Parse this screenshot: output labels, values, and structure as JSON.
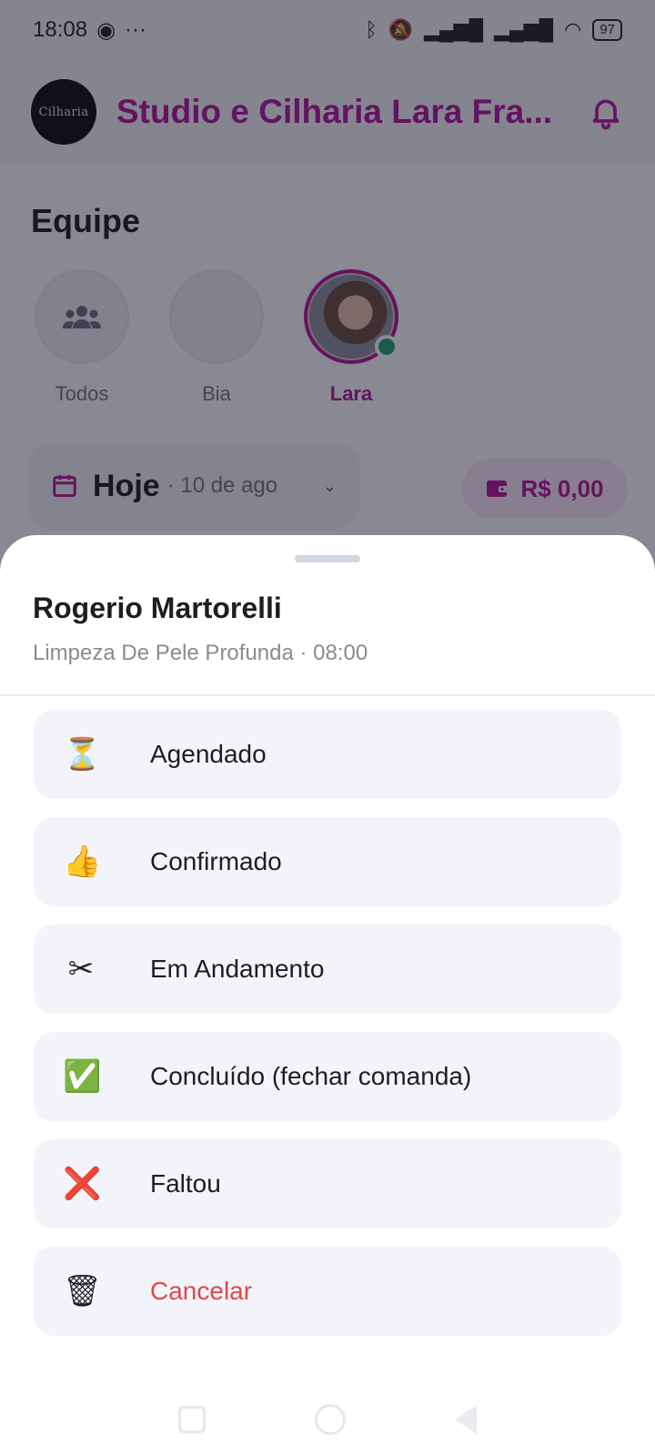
{
  "status_bar": {
    "time": "18:08",
    "battery": "97"
  },
  "header": {
    "title": "Studio e Cilharia Lara Fra...",
    "logo_text": "Cilharia"
  },
  "team": {
    "title": "Equipe",
    "members": [
      {
        "label": "Todos"
      },
      {
        "label": "Bia"
      },
      {
        "label": "Lara"
      }
    ]
  },
  "date_filter": {
    "main": "Hoje",
    "sub": "· 10 de ago"
  },
  "balance": {
    "value": "R$ 0,00"
  },
  "sheet": {
    "client_name": "Rogerio Martorelli",
    "subtitle": "Limpeza De Pele Profunda · 08:00",
    "actions": [
      {
        "label": "Agendado",
        "icon": "⏳",
        "icon_name": "hourglass-icon"
      },
      {
        "label": "Confirmado",
        "icon": "👍",
        "icon_name": "thumbs-up-icon"
      },
      {
        "label": "Em Andamento",
        "icon": "✂",
        "icon_name": "scissors-icon"
      },
      {
        "label": "Concluído (fechar comanda)",
        "icon": "✅",
        "icon_name": "check-mark-icon"
      },
      {
        "label": "Faltou",
        "icon": "❌",
        "icon_name": "cross-mark-icon"
      },
      {
        "label": "Cancelar",
        "icon": "🗑",
        "icon_name": "trash-icon"
      }
    ]
  },
  "colors": {
    "brand": "#b5129a",
    "danger": "#e04848",
    "online": "#21a36a"
  }
}
